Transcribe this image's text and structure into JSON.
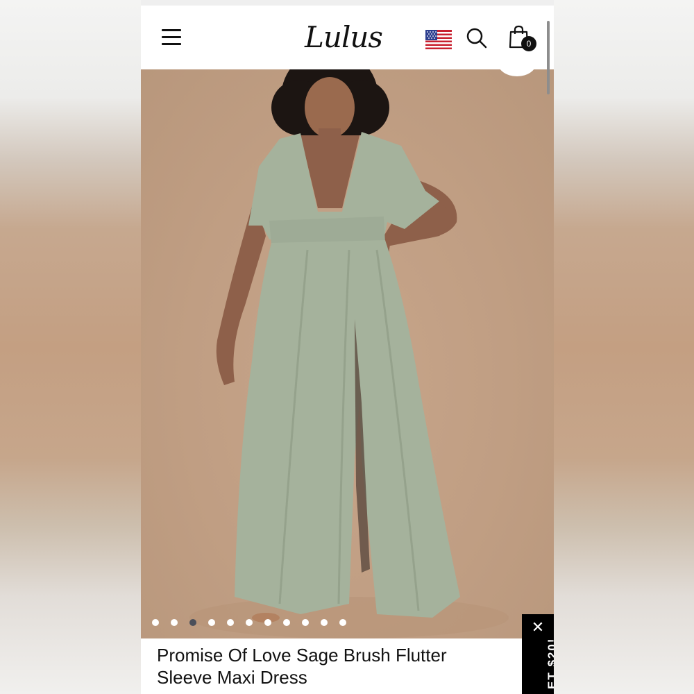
{
  "header": {
    "logo_text": "Lulus",
    "cart_count": "0"
  },
  "gallery": {
    "slide_count": 11,
    "active_slide": 3
  },
  "product": {
    "title_line1": "Promise Of Love Sage Brush Flutter",
    "title_line2": "Sleeve Maxi Dress"
  },
  "promo": {
    "tab_text": "ET $20!",
    "close_symbol": "✕"
  },
  "colors": {
    "background": "#c4a185",
    "dress": "#a5b29c",
    "header_bg": "#ffffff",
    "promo_bg": "#000000"
  }
}
